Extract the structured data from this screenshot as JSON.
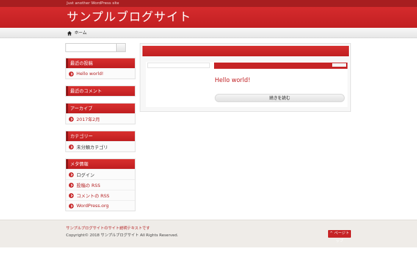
{
  "site": {
    "tagline": "Just another WordPress site",
    "title": "サンプルブログサイト"
  },
  "nav": {
    "home_label": "ホーム"
  },
  "search": {
    "placeholder": "",
    "button_label": ""
  },
  "sidebar": {
    "widgets": [
      {
        "title": "最近の投稿",
        "items": [
          "Hello world!"
        ]
      },
      {
        "title": "最近のコメント",
        "items": []
      },
      {
        "title": "アーカイブ",
        "items": [
          "2017年2月"
        ]
      },
      {
        "title": "カテゴリー",
        "items": [
          "未分類カテゴリ"
        ]
      },
      {
        "title": "メタ情報",
        "items": [
          "ログイン",
          "投稿の RSS",
          "コメントの RSS",
          "WordPress.org"
        ]
      }
    ]
  },
  "main": {
    "post": {
      "date": "",
      "title": "Hello world!",
      "more_label": "続きを読む"
    }
  },
  "footer": {
    "description": "サンプルブログサイトのサイト説明テキストです",
    "copyright": "Copyright© 2018 サンプルブログサイト All Rights Reserved.",
    "pagetop_label": "ページトップ"
  },
  "colors": {
    "accent": "#c62426",
    "accent_dark": "#a81e20",
    "footer_bg": "#efece8"
  }
}
